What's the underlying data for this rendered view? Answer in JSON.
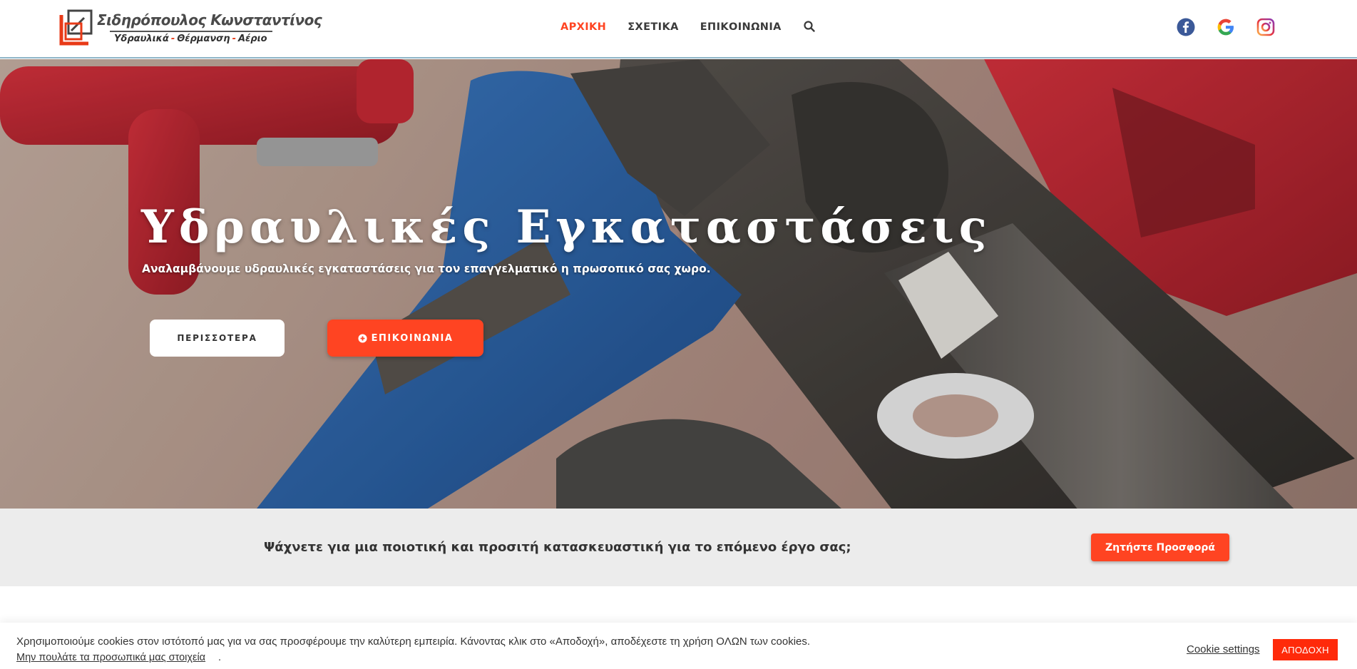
{
  "header": {
    "logo": {
      "name": "Σιδηρόπουλος Κωνσταντίνος",
      "tagline_parts": [
        "Υδραυλικά",
        "Θέρμανση",
        "Αέριο"
      ]
    },
    "nav": {
      "items": [
        {
          "label": "ΑΡΧΙΚΗ",
          "active": true
        },
        {
          "label": "ΣΧΕΤΙΚΑ",
          "active": false
        },
        {
          "label": "ΕΠΙΚΟΙΝΩΝΙΑ",
          "active": false
        }
      ],
      "search_icon": "search-icon"
    },
    "social": [
      "facebook-icon",
      "google-icon",
      "instagram-icon"
    ]
  },
  "hero": {
    "title": "Υδραυλικές Εγκαταστάσεις",
    "subtitle": "Αναλαμβάνουμε υδραυλικές εγκαταστάσεις για τον επαγγελματικό η πρωσοπικό σας χωρο.",
    "btn_more": "ΠΕΡΙΣΣΟΤΕΡΑ",
    "btn_contact": "ΕΠΙΚΟΙΝΩΝΙΑ"
  },
  "cta": {
    "text": "Ψάχνετε για μια ποιοτική και προσιτή κατασκευαστική για το επόμενο έργο σας;",
    "button": "Ζητήστε Προσφορά"
  },
  "cookie": {
    "text": "Χρησιμοποιούμε cookies στον ιστότοπό μας για να σας προσφέρουμε την καλύτερη εμπειρία. Κάνοντας κλικ στο «Αποδοχή», αποδέχεστε τη χρήση ΟΛΩΝ των cookies.",
    "link": "Μην πουλάτε τα προσωπικά μας στοιχεία",
    "link_suffix": ".",
    "settings": "Cookie settings",
    "accept": "ΑΠΟΔΟΧΗ"
  },
  "colors": {
    "accent": "#ff4422",
    "text_dark": "#333333",
    "cta_band": "#ececec"
  }
}
